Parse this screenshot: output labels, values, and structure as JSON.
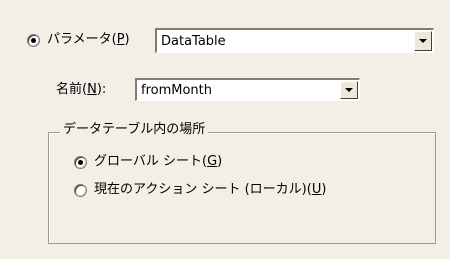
{
  "parameter": {
    "label": "パラメータ(",
    "mnemonic": "P",
    "label_suffix": ")",
    "selected": true,
    "value": "DataTable"
  },
  "name": {
    "label": "名前(",
    "mnemonic": "N",
    "label_suffix": "):",
    "value": "fromMonth"
  },
  "location_group": {
    "title": "データテーブル内の場所",
    "options": [
      {
        "label": "グローバル シート(",
        "mnemonic": "G",
        "label_suffix": ")",
        "selected": true
      },
      {
        "label": "現在のアクション シート (ローカル)(",
        "mnemonic": "U",
        "label_suffix": ")",
        "selected": false
      }
    ]
  }
}
